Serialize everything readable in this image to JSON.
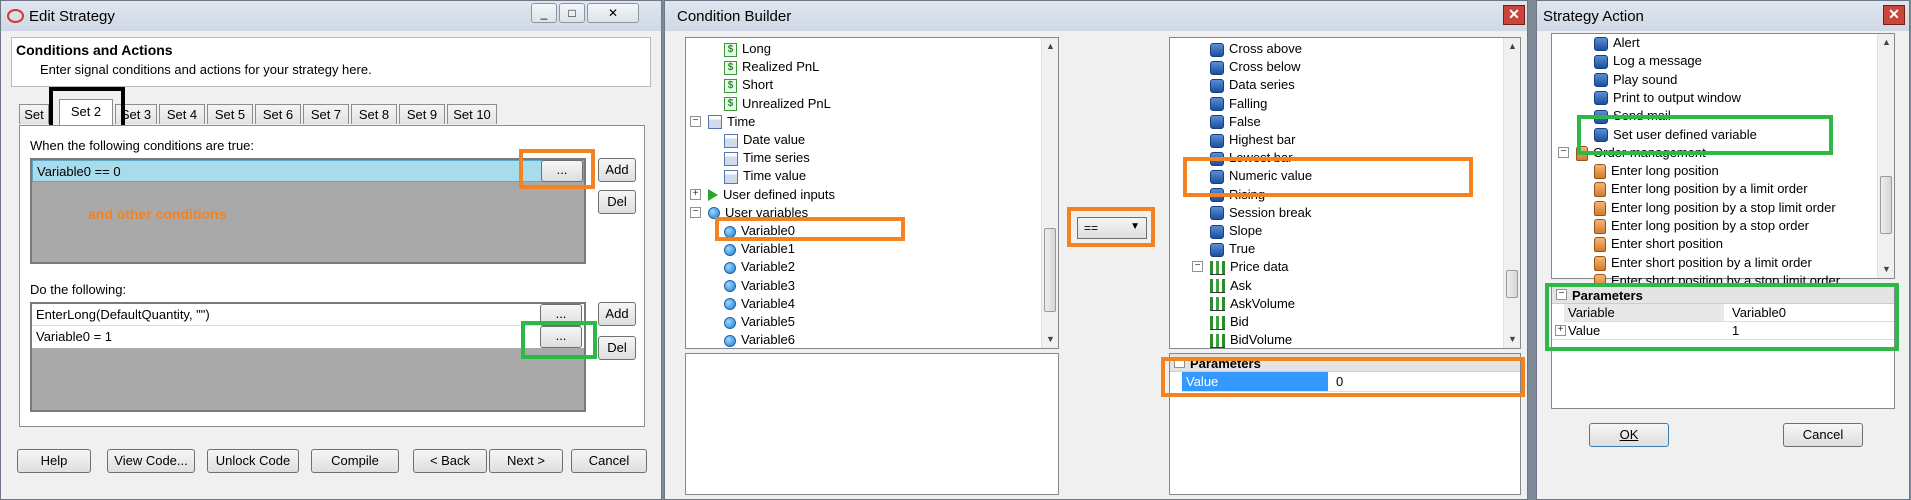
{
  "edit_strategy": {
    "title": "Edit Strategy",
    "header_title": "Conditions and Actions",
    "header_desc": "Enter signal conditions and actions for your strategy here.",
    "tabs": [
      "Set",
      "Set 2",
      "Set 3",
      "Set 4",
      "Set 5",
      "Set 6",
      "Set 7",
      "Set 8",
      "Set 9",
      "Set 10"
    ],
    "active_tab": "Set 2",
    "conditions_label": "When the following conditions are true:",
    "condition_row": "Variable0 == 0",
    "annotation": "and other conditions",
    "actions_label": "Do the following:",
    "action_rows": [
      "EnterLong(DefaultQuantity, \"\")",
      "Variable0 = 1"
    ],
    "ellipsis": "...",
    "add_label": "Add",
    "del_label": "Del",
    "footer_buttons": [
      "Help",
      "View Code...",
      "Unlock Code",
      "Compile",
      "< Back",
      "Next >",
      "Cancel"
    ],
    "title_buttons": [
      "_",
      "□",
      "✕"
    ]
  },
  "condition_builder": {
    "title": "Condition Builder",
    "left_items": [
      {
        "label": "Long",
        "icon": "dollar-icon"
      },
      {
        "label": "Realized PnL",
        "icon": "dollar-icon"
      },
      {
        "label": "Short",
        "icon": "dollar-icon"
      },
      {
        "label": "Unrealized PnL",
        "icon": "dollar-icon"
      },
      {
        "label": "Time",
        "icon": "calendar-icon",
        "expander": "−"
      },
      {
        "label": "Date value",
        "icon": "calendar-icon"
      },
      {
        "label": "Time series",
        "icon": "calendar-icon"
      },
      {
        "label": "Time value",
        "icon": "calendar-icon"
      },
      {
        "label": "User defined inputs",
        "icon": "play-icon",
        "expander": "+"
      },
      {
        "label": "User variables",
        "icon": "variable-icon",
        "expander": "−"
      },
      {
        "label": "Variable0",
        "icon": "variable-icon"
      },
      {
        "label": "Variable1",
        "icon": "variable-icon"
      },
      {
        "label": "Variable2",
        "icon": "variable-icon"
      },
      {
        "label": "Variable3",
        "icon": "variable-icon"
      },
      {
        "label": "Variable4",
        "icon": "variable-icon"
      },
      {
        "label": "Variable5",
        "icon": "variable-icon"
      },
      {
        "label": "Variable6",
        "icon": "variable-icon"
      }
    ],
    "operator": "==",
    "right_items": [
      {
        "label": "Cross above",
        "icon": "database-icon"
      },
      {
        "label": "Cross below",
        "icon": "database-icon"
      },
      {
        "label": "Data series",
        "icon": "database-icon"
      },
      {
        "label": "Falling",
        "icon": "database-icon"
      },
      {
        "label": "False",
        "icon": "database-icon"
      },
      {
        "label": "Highest bar",
        "icon": "database-icon"
      },
      {
        "label": "Lowest bar",
        "icon": "database-icon"
      },
      {
        "label": "Numeric value",
        "icon": "database-icon"
      },
      {
        "label": "Rising",
        "icon": "database-icon"
      },
      {
        "label": "Session break",
        "icon": "database-icon"
      },
      {
        "label": "Slope",
        "icon": "database-icon"
      },
      {
        "label": "True",
        "icon": "database-icon"
      },
      {
        "label": "Price data",
        "icon": "bars-icon",
        "expander": "−"
      },
      {
        "label": "Ask",
        "icon": "bars-icon"
      },
      {
        "label": "AskVolume",
        "icon": "bars-icon"
      },
      {
        "label": "Bid",
        "icon": "bars-icon"
      },
      {
        "label": "BidVolume",
        "icon": "bars-icon"
      }
    ],
    "params_header": "Parameters",
    "param_name": "Value",
    "param_value": "0",
    "close_label": "✕"
  },
  "strategy_action": {
    "title": "Strategy Action",
    "items": [
      {
        "label": "Alert",
        "icon": "database-icon"
      },
      {
        "label": "Log a message",
        "icon": "database-icon"
      },
      {
        "label": "Play sound",
        "icon": "database-icon"
      },
      {
        "label": "Print to output window",
        "icon": "database-icon"
      },
      {
        "label": "Send mail",
        "icon": "database-icon"
      },
      {
        "label": "Set user defined variable",
        "icon": "database-icon"
      },
      {
        "label": "Order management",
        "icon": "hand-icon",
        "expander": "−"
      },
      {
        "label": "Enter long position",
        "icon": "hand-icon"
      },
      {
        "label": "Enter long position by a limit order",
        "icon": "hand-icon"
      },
      {
        "label": "Enter long position by a stop limit order",
        "icon": "hand-icon"
      },
      {
        "label": "Enter long position by a stop order",
        "icon": "hand-icon"
      },
      {
        "label": "Enter short position",
        "icon": "hand-icon"
      },
      {
        "label": "Enter short position by a limit order",
        "icon": "hand-icon"
      },
      {
        "label": "Enter short position by a stop limit order",
        "icon": "hand-icon"
      }
    ],
    "params_header": "Parameters",
    "params": [
      {
        "name": "Variable",
        "value": "Variable0"
      },
      {
        "name": "Value",
        "value": "1"
      }
    ],
    "ok_label": "OK",
    "cancel_label": "Cancel",
    "close_label": "✕"
  },
  "colors": {
    "highlight_orange": "#f58220",
    "highlight_green": "#2eb84a",
    "highlight_black": "#000000",
    "selection_blue": "#3399ff",
    "row_selected": "#a8dcec"
  }
}
